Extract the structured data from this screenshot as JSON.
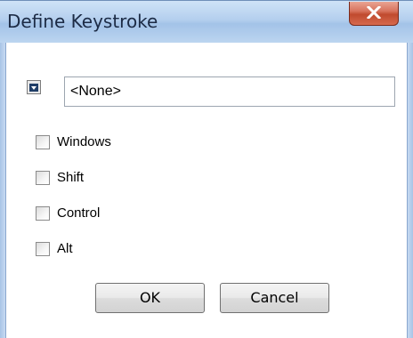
{
  "window": {
    "title": "Define Keystroke"
  },
  "icons": {
    "close": "close-x-icon",
    "combo": "dropdown-toggle-icon"
  },
  "keystroke": {
    "value": "<None>"
  },
  "modifiers": [
    {
      "label": "Windows",
      "checked": false
    },
    {
      "label": "Shift",
      "checked": false
    },
    {
      "label": "Control",
      "checked": false
    },
    {
      "label": "Alt",
      "checked": false
    }
  ],
  "buttons": {
    "ok": "OK",
    "cancel": "Cancel"
  }
}
